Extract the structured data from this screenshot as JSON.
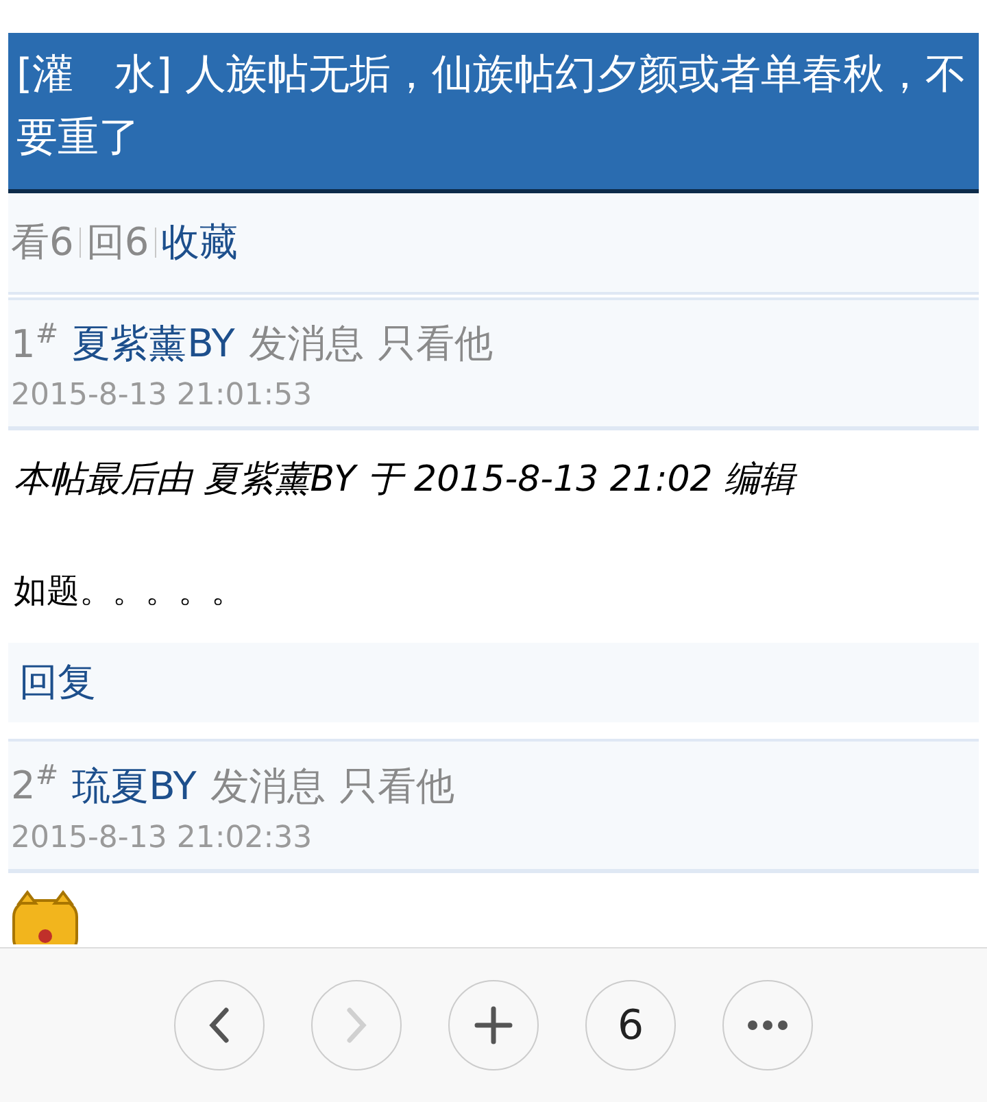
{
  "thread": {
    "title": "[灌　水] 人族帖无垢，仙族帖幻夕颜或者单春秋，不要重了"
  },
  "stats": [
    {
      "kind": "count",
      "text": "看6"
    },
    {
      "kind": "count",
      "text": "回6"
    },
    {
      "kind": "link",
      "text": "收藏"
    }
  ],
  "posts": [
    {
      "floor": "1$^{#}$",
      "author": "夏紫薰BY",
      "actions": [
        "发消息",
        "只看他"
      ],
      "time": "2015-8-13 21:01:53",
      "edit_note": "本帖最后由 夏紫薰BY 于 2015-8-13 21:02 编辑",
      "kind": "text",
      "body": "如题。。。。。",
      "reply": "回复"
    },
    {
      "floor": "2$^{#}$",
      "author": "琉夏BY",
      "actions": [
        "发消息",
        "只看他"
      ],
      "time": "2015-8-13 21:02:33",
      "kind": "emoticon"
    }
  ],
  "toolbar": [
    {
      "kind": "back",
      "disabled": false
    },
    {
      "kind": "forward",
      "disabled": true
    },
    {
      "kind": "new-tab",
      "disabled": false
    },
    {
      "kind": "tabs",
      "text": "6",
      "disabled": false
    },
    {
      "kind": "menu",
      "disabled": false
    }
  ]
}
